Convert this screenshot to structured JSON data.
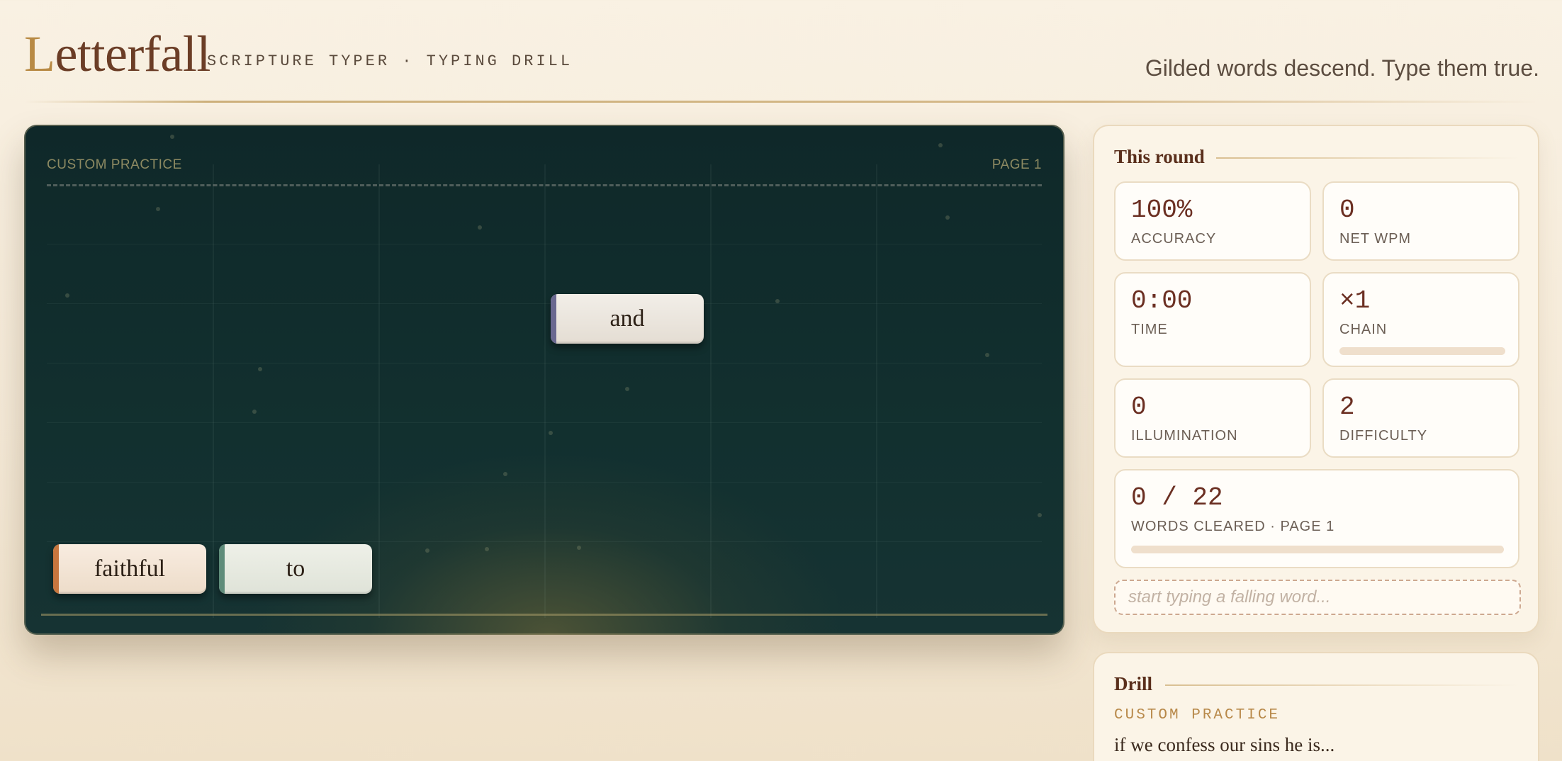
{
  "header": {
    "brand_initial": "L",
    "brand_rest": "etterfall",
    "tagline": "SCRIPTURE TYPER · TYPING DRILL",
    "motto": "Gilded words descend. Type them true."
  },
  "playfield": {
    "label_left": "CUSTOM PRACTICE",
    "label_right": "PAGE 1",
    "words": [
      {
        "text": "and",
        "accent": "#6a6890"
      },
      {
        "text": "faithful",
        "accent": "#c7763e"
      },
      {
        "text": "to",
        "accent": "#5f8c7a"
      }
    ]
  },
  "round": {
    "title": "This round",
    "accuracy": {
      "value": "100%",
      "label": "ACCURACY"
    },
    "wpm": {
      "value": "0",
      "label": "NET WPM"
    },
    "time": {
      "value": "0:00",
      "label": "TIME"
    },
    "chain": {
      "value": "×1",
      "label": "CHAIN",
      "progress": 0
    },
    "illumination": {
      "value": "0",
      "label": "ILLUMINATION"
    },
    "difficulty": {
      "value": "2",
      "label": "DIFFICULTY"
    },
    "cleared": {
      "value": "0 / 22",
      "label": "WORDS CLEARED · PAGE 1",
      "progress": 0
    },
    "input_placeholder": "start typing a falling word..."
  },
  "drill": {
    "title": "Drill",
    "kind": "CUSTOM PRACTICE",
    "text": "if we confess our sins he is..."
  },
  "colors": {
    "accent_gold": "#b88a44",
    "ink": "#6b2f22",
    "playfield_bg": "#12302f"
  }
}
